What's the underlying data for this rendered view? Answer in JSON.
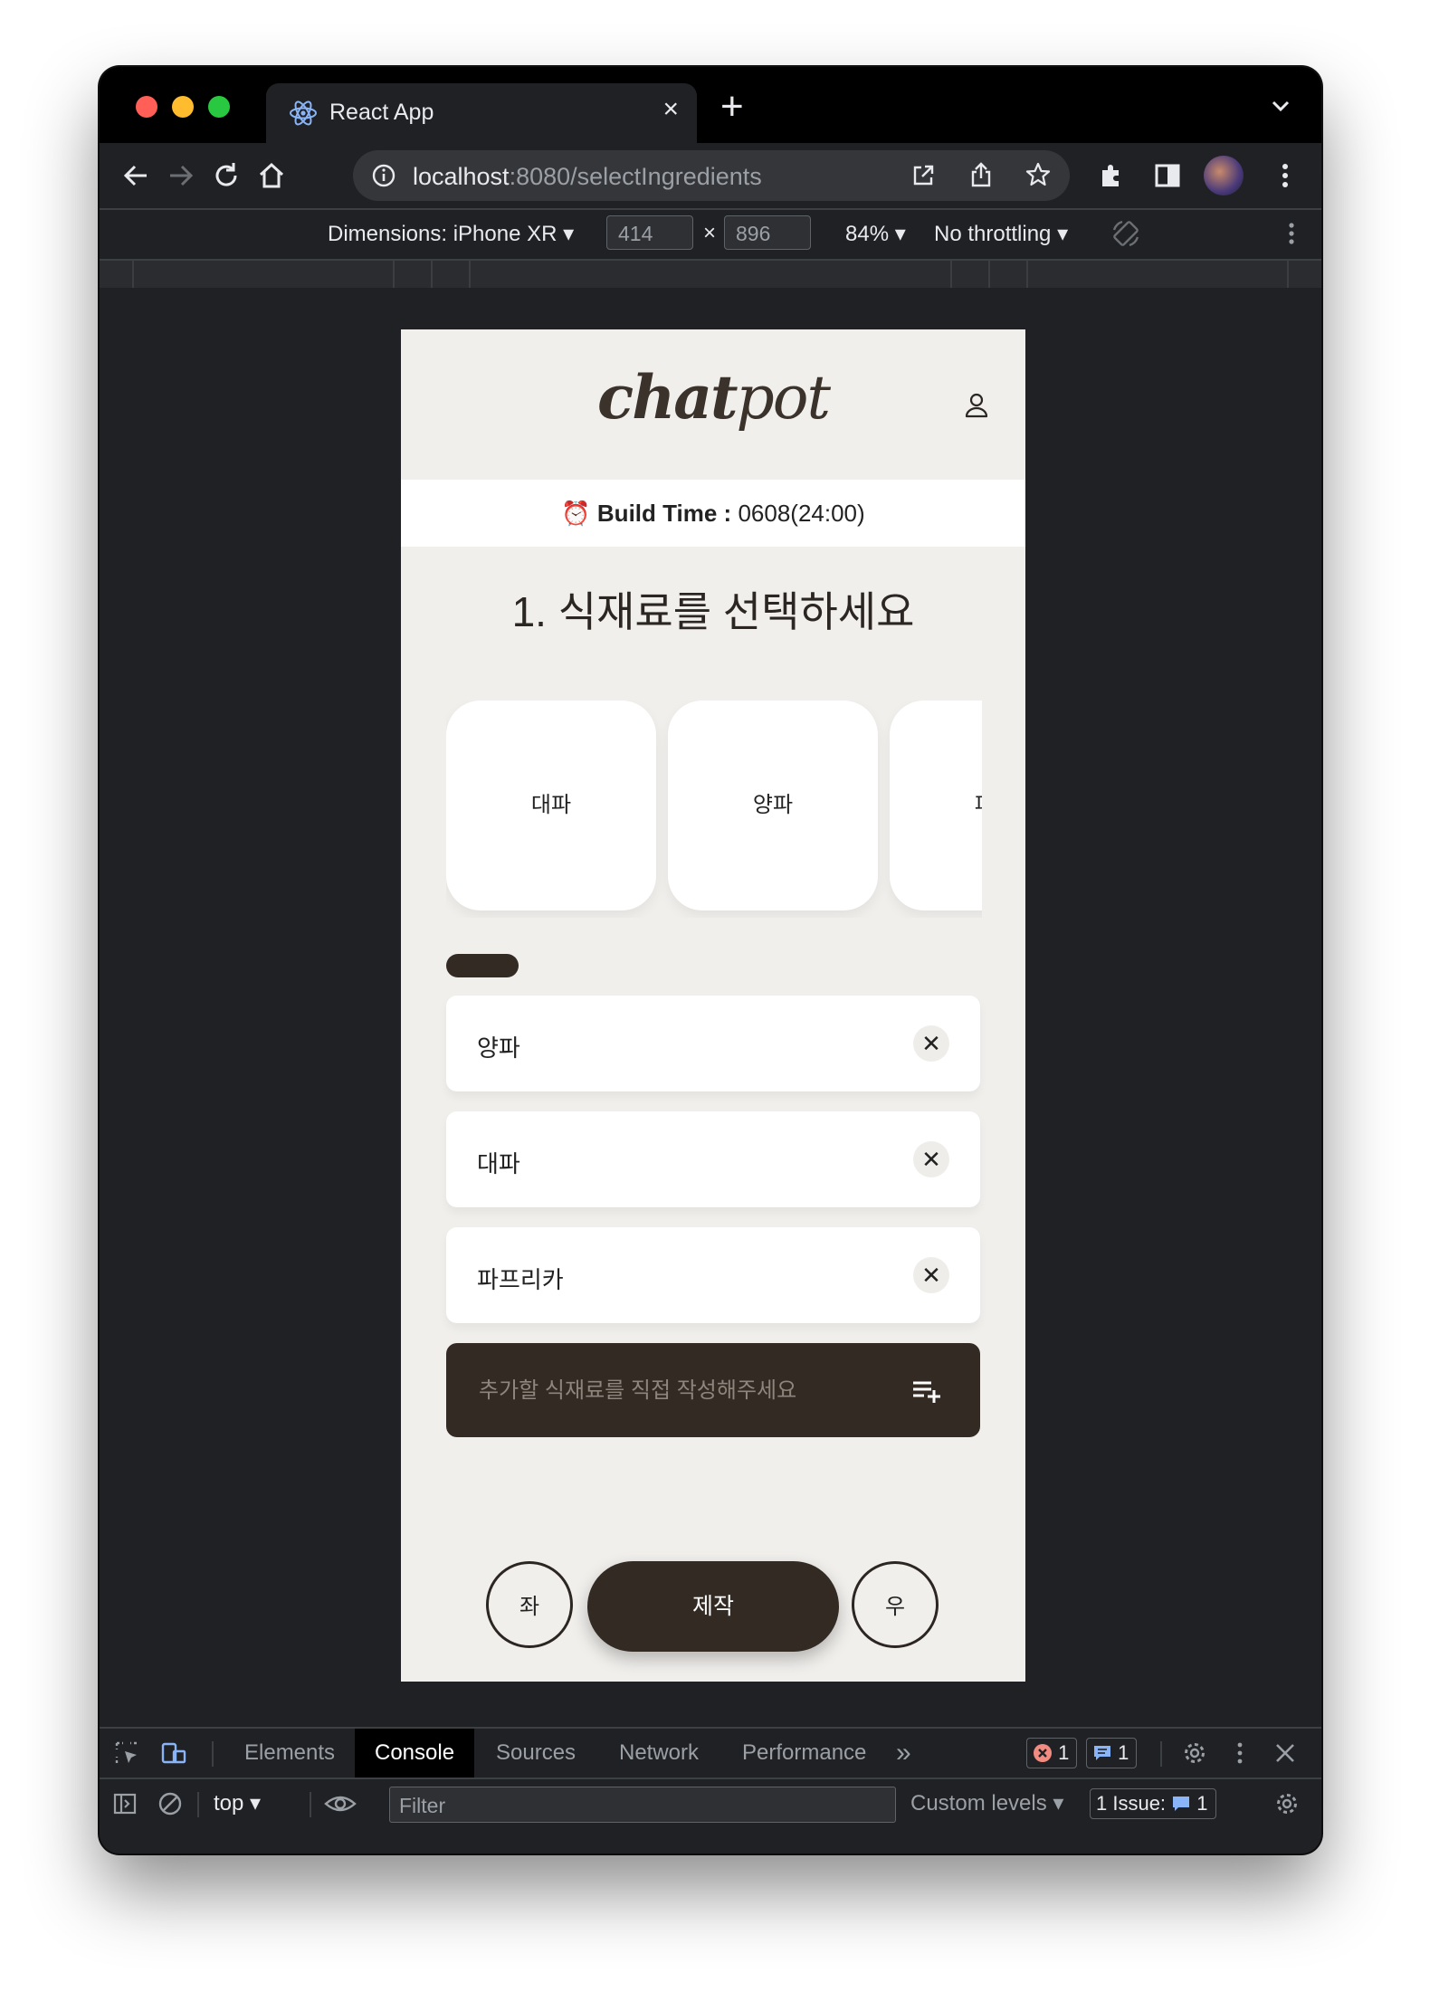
{
  "browser": {
    "tab_title": "React App",
    "url_host": "localhost",
    "url_rest": ":8080/selectIngredients",
    "new_tab": "+"
  },
  "device_toolbar": {
    "dimensions_label": "Dimensions: iPhone XR ▾",
    "width": "414",
    "times": "×",
    "height": "896",
    "zoom": "84% ▾",
    "throttling": "No throttling ▾"
  },
  "app": {
    "logo_bold": "chat",
    "logo_light": "pot",
    "build_label": "Build Time :",
    "build_value": "0608(24:00)",
    "build_emoji": "⏰",
    "step_title": "1. 식재료를 선택하세요",
    "cards": [
      "대파",
      "양파",
      "파프"
    ],
    "selected_items": [
      "양파",
      "대파",
      "파프리카"
    ],
    "remove_glyph": "✕",
    "add_placeholder": "추가할 식재료를 직접 작성해주세요",
    "left_button": "좌",
    "make_button": "제작",
    "right_button": "우"
  },
  "devtools": {
    "tabs": [
      "Elements",
      "Console",
      "Sources",
      "Network",
      "Performance"
    ],
    "more": "»",
    "error_count": "1",
    "message_count": "1",
    "context": "top",
    "filter_placeholder": "Filter",
    "levels": "Custom levels ▾",
    "issues_label": "1 Issue:",
    "issues_count": "1"
  },
  "colors": {
    "accent_dark": "#332a24",
    "app_background": "#f1efec",
    "chrome_dark": "#202124"
  }
}
